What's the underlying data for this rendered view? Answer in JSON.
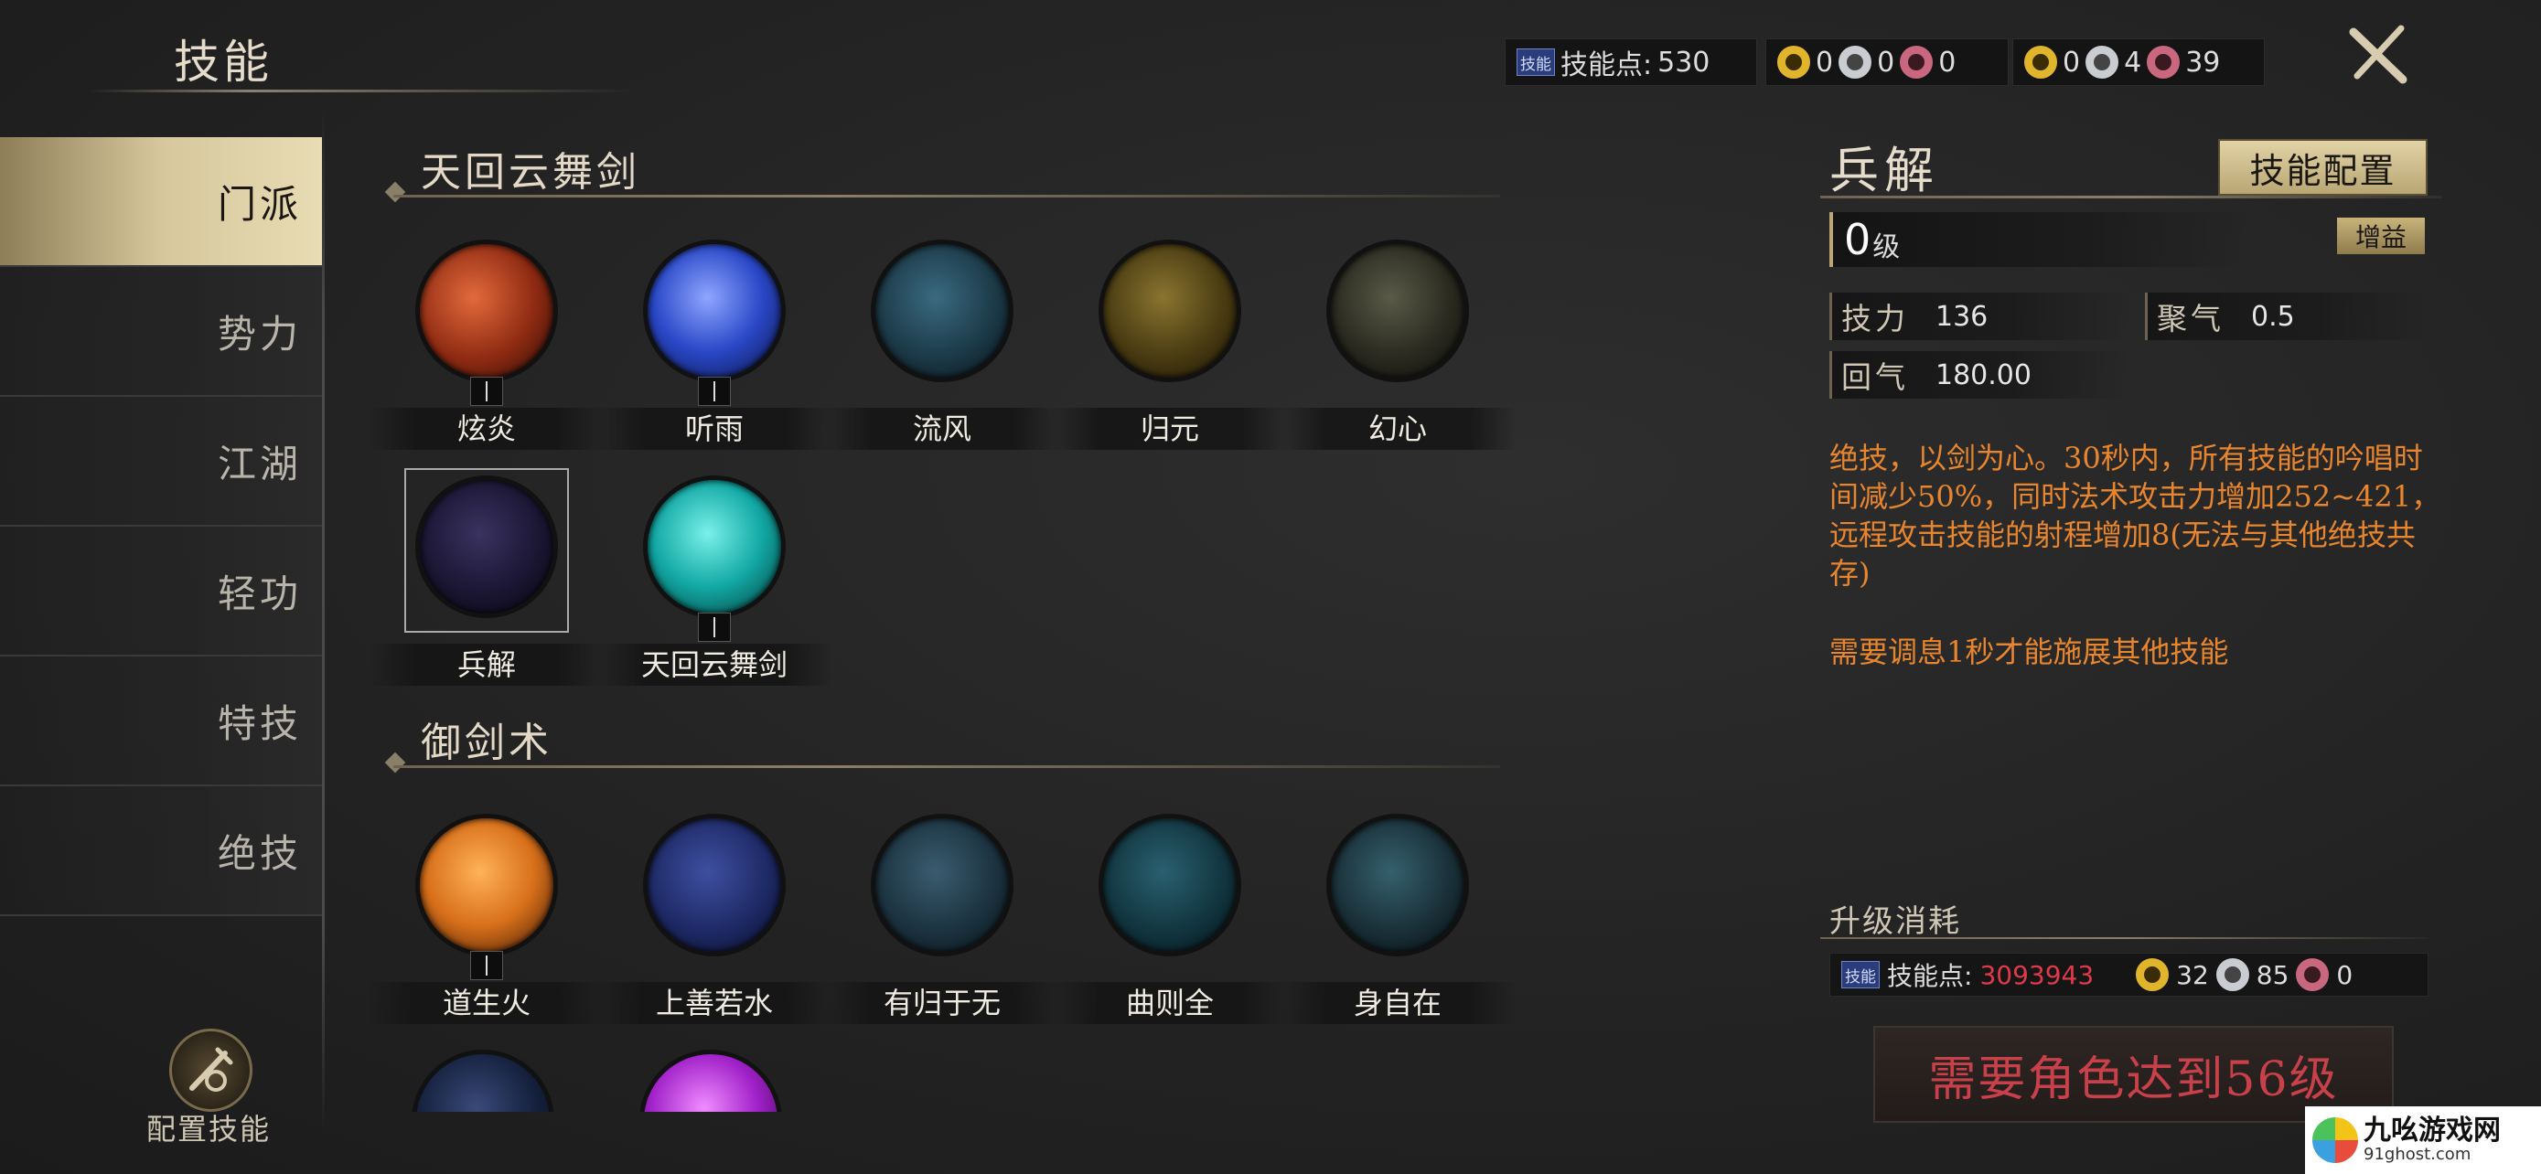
{
  "header": {
    "title": "技能",
    "skill_points_tag": "技能",
    "skill_points_label": "技能点:",
    "skill_points_value": "530",
    "currency_a": [
      "0",
      "0",
      "0"
    ],
    "currency_b": [
      "0",
      "4",
      "39"
    ],
    "close_icon": "close-x-icon"
  },
  "sidebar": {
    "items": [
      {
        "label": "门派"
      },
      {
        "label": "势力"
      },
      {
        "label": "江湖"
      },
      {
        "label": "轻功"
      },
      {
        "label": "特技"
      },
      {
        "label": "绝技"
      }
    ],
    "active_index": 0,
    "config_label": "配置技能"
  },
  "sections": [
    {
      "title": "天回云舞剑",
      "skills": [
        {
          "name": "炫炎",
          "color": "#b23a1e",
          "level_slot": true
        },
        {
          "name": "听雨",
          "color": "#2a48c8",
          "level_slot": true
        },
        {
          "name": "流风",
          "color": "#1c3a48",
          "level_slot": false
        },
        {
          "name": "归元",
          "color": "#4a3c12",
          "level_slot": false
        },
        {
          "name": "幻心",
          "color": "#2a2a20",
          "level_slot": false
        },
        {
          "name": "兵解",
          "color": "#1a1633",
          "level_slot": false,
          "selected": true
        },
        {
          "name": "天回云舞剑",
          "color": "#12a8a4",
          "level_slot": true
        }
      ]
    },
    {
      "title": "御剑术",
      "skills": [
        {
          "name": "道生火",
          "color": "#d8701a",
          "level_slot": true
        },
        {
          "name": "上善若水",
          "color": "#1e2a66",
          "level_slot": false
        },
        {
          "name": "有归于无",
          "color": "#1c3340",
          "level_slot": false
        },
        {
          "name": "曲则全",
          "color": "#123640",
          "level_slot": false
        },
        {
          "name": "身自在",
          "color": "#1a3038",
          "level_slot": false
        }
      ]
    }
  ],
  "detail": {
    "title": "兵解",
    "config_button": "技能配置",
    "level": "0",
    "level_unit": "级",
    "buff_tag": "增益",
    "stats": [
      {
        "label": "技力",
        "value": "136"
      },
      {
        "label": "聚气",
        "value": "0.5"
      },
      {
        "label": "回气",
        "value": "180.00"
      }
    ],
    "description": "绝技，以剑为心。30秒内，所有技能的吟唱时间减少50%，同时法术攻击力增加252~421，远程攻击技能的射程增加8(无法与其他绝技共存)",
    "description2": "需要调息1秒才能施展其他技能",
    "upgrade_title": "升级消耗",
    "upgrade_tag": "技能",
    "upgrade_points_label": "技能点:",
    "upgrade_points_value": "3093943",
    "upgrade_gold": "32",
    "upgrade_silver": "85",
    "upgrade_copper": "0",
    "requirement_button": "需要角色达到56级"
  },
  "watermark": {
    "line1": "九吆游戏网",
    "line2": "91ghost.com"
  },
  "colors": {
    "accent_gold": "#d6c79c",
    "desc_orange": "#e8862f",
    "cost_red": "#e0394a"
  }
}
